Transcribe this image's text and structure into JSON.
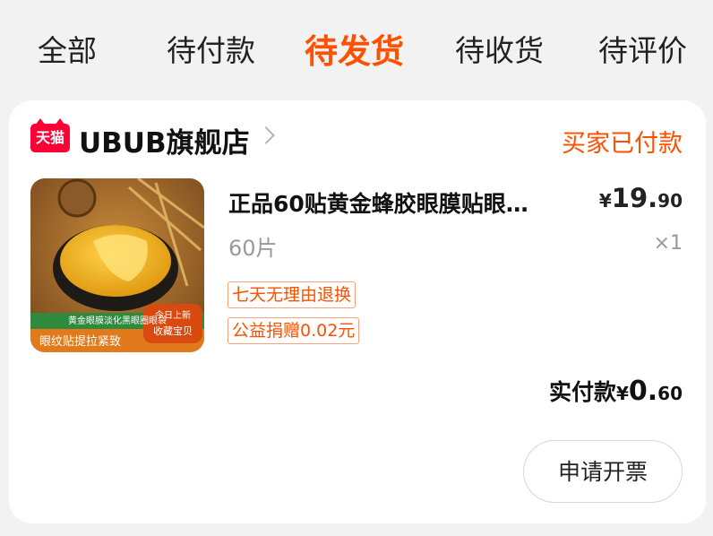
{
  "tabs": [
    {
      "label": "全部"
    },
    {
      "label": "待付款"
    },
    {
      "label": "待发货"
    },
    {
      "label": "待收货"
    },
    {
      "label": "待评价"
    }
  ],
  "order": {
    "shop_badge": "天猫",
    "shop_name": "UBUB旗舰店",
    "status": "买家已付款",
    "product": {
      "title": "正品60贴黄金蜂胶眼膜贴眼…",
      "spec": "60片",
      "price_symbol": "¥",
      "price_int": "19.",
      "price_dec": "90",
      "quantity": "×1",
      "image_texts": {
        "banner": "黄金眼膜淡化黑眼圈眼袋",
        "footer": "眼纹贴提拉紧致",
        "badge_line1": "今日上新",
        "badge_line2": "收藏宝贝"
      }
    },
    "tags": [
      "七天无理由退换",
      "公益捐赠0.02元"
    ],
    "paid_label": "实付款",
    "paid_symbol": "¥",
    "paid_int": "0.",
    "paid_dec": "60",
    "invoice_button": "申请开票"
  },
  "colors": {
    "accent": "#ff5000",
    "tmall_red": "#ff0036"
  }
}
